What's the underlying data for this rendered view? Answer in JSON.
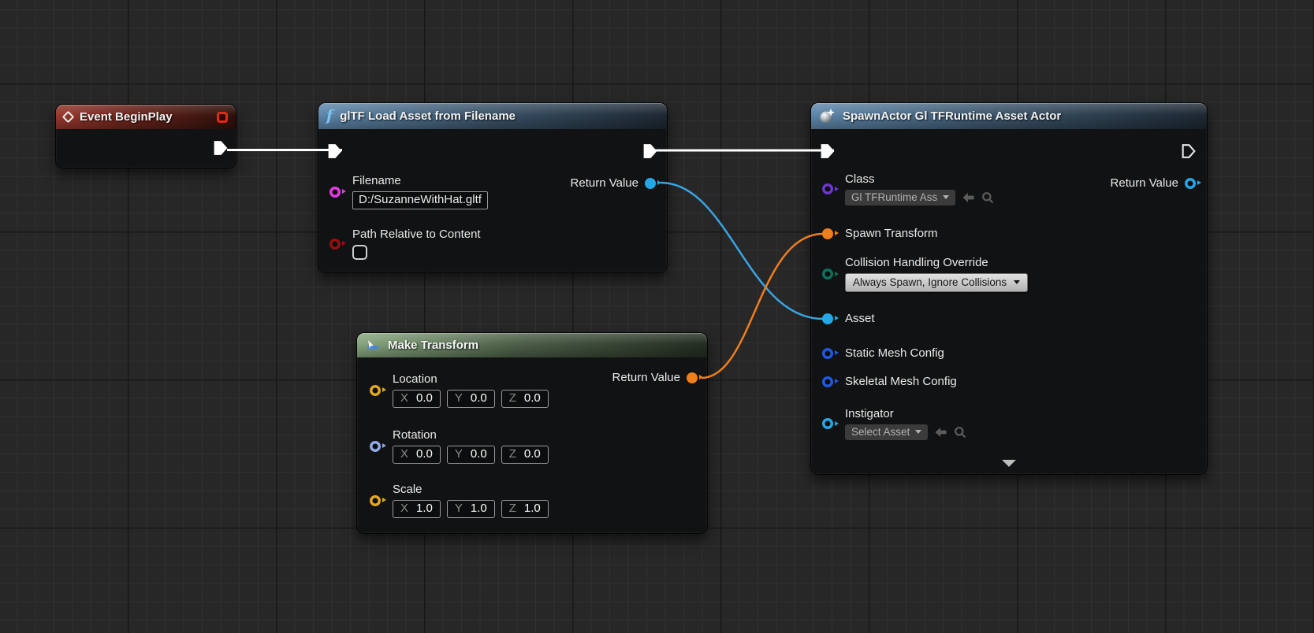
{
  "canvas": {
    "background": "#272727",
    "grid_minor_color": "#313131",
    "grid_major_color": "#181818"
  },
  "colors": {
    "exec_wire": "#ffffff",
    "object_wire": "#3aa3e3",
    "transform_wire": "#ee7f1d",
    "pin_string": "#e23be2",
    "pin_bool": "#970f0f",
    "pin_object": "#23a7e8",
    "pin_class": "#6e35cf",
    "pin_enum": "#0d6e5f",
    "pin_config": "#1e5ae0",
    "pin_transform": "#ee7f1d",
    "pin_vector": "#dfa71c",
    "pin_rotator": "#8fa9e6",
    "header_event": "#96382d",
    "header_function": "#5e87ab",
    "header_make": "#86a67e"
  },
  "icons": {
    "event": "diamond-outline",
    "event_glyph": "",
    "function_glyph": "f",
    "spawn": "sphere-sparkle",
    "make": "make-struct-arrow",
    "expand": "chevron-down"
  },
  "nodes": {
    "event_begin_play": {
      "title": "Event BeginPlay"
    },
    "gltf_load": {
      "title": "glTF Load Asset from Filename",
      "pins": {
        "filename": {
          "label": "Filename",
          "value": "D:/SuzanneWithHat.gltf"
        },
        "path_relative": {
          "label": "Path Relative to Content",
          "checked": false
        },
        "return_value": {
          "label": "Return Value"
        }
      }
    },
    "make_transform": {
      "title": "Make Transform",
      "return_value_label": "Return Value",
      "rows": [
        {
          "label": "Location",
          "fields": [
            {
              "axis": "X",
              "value": "0.0"
            },
            {
              "axis": "Y",
              "value": "0.0"
            },
            {
              "axis": "Z",
              "value": "0.0"
            }
          ]
        },
        {
          "label": "Rotation",
          "fields": [
            {
              "axis": "X",
              "value": "0.0"
            },
            {
              "axis": "Y",
              "value": "0.0"
            },
            {
              "axis": "Z",
              "value": "0.0"
            }
          ]
        },
        {
          "label": "Scale",
          "fields": [
            {
              "axis": "X",
              "value": "1.0"
            },
            {
              "axis": "Y",
              "value": "1.0"
            },
            {
              "axis": "Z",
              "value": "1.0"
            }
          ]
        }
      ]
    },
    "spawn_actor": {
      "title": "SpawnActor Gl TFRuntime Asset Actor",
      "pins": {
        "class": {
          "label": "Class",
          "value": "Gl TFRuntime Ass"
        },
        "spawn_transform": {
          "label": "Spawn Transform"
        },
        "collision": {
          "label": "Collision Handling Override",
          "value": "Always Spawn, Ignore Collisions"
        },
        "asset": {
          "label": "Asset"
        },
        "static_mesh": {
          "label": "Static Mesh Config"
        },
        "skeletal_mesh": {
          "label": "Skeletal Mesh Config"
        },
        "instigator": {
          "label": "Instigator",
          "value": "Select Asset"
        },
        "return_value": {
          "label": "Return Value"
        }
      }
    }
  }
}
